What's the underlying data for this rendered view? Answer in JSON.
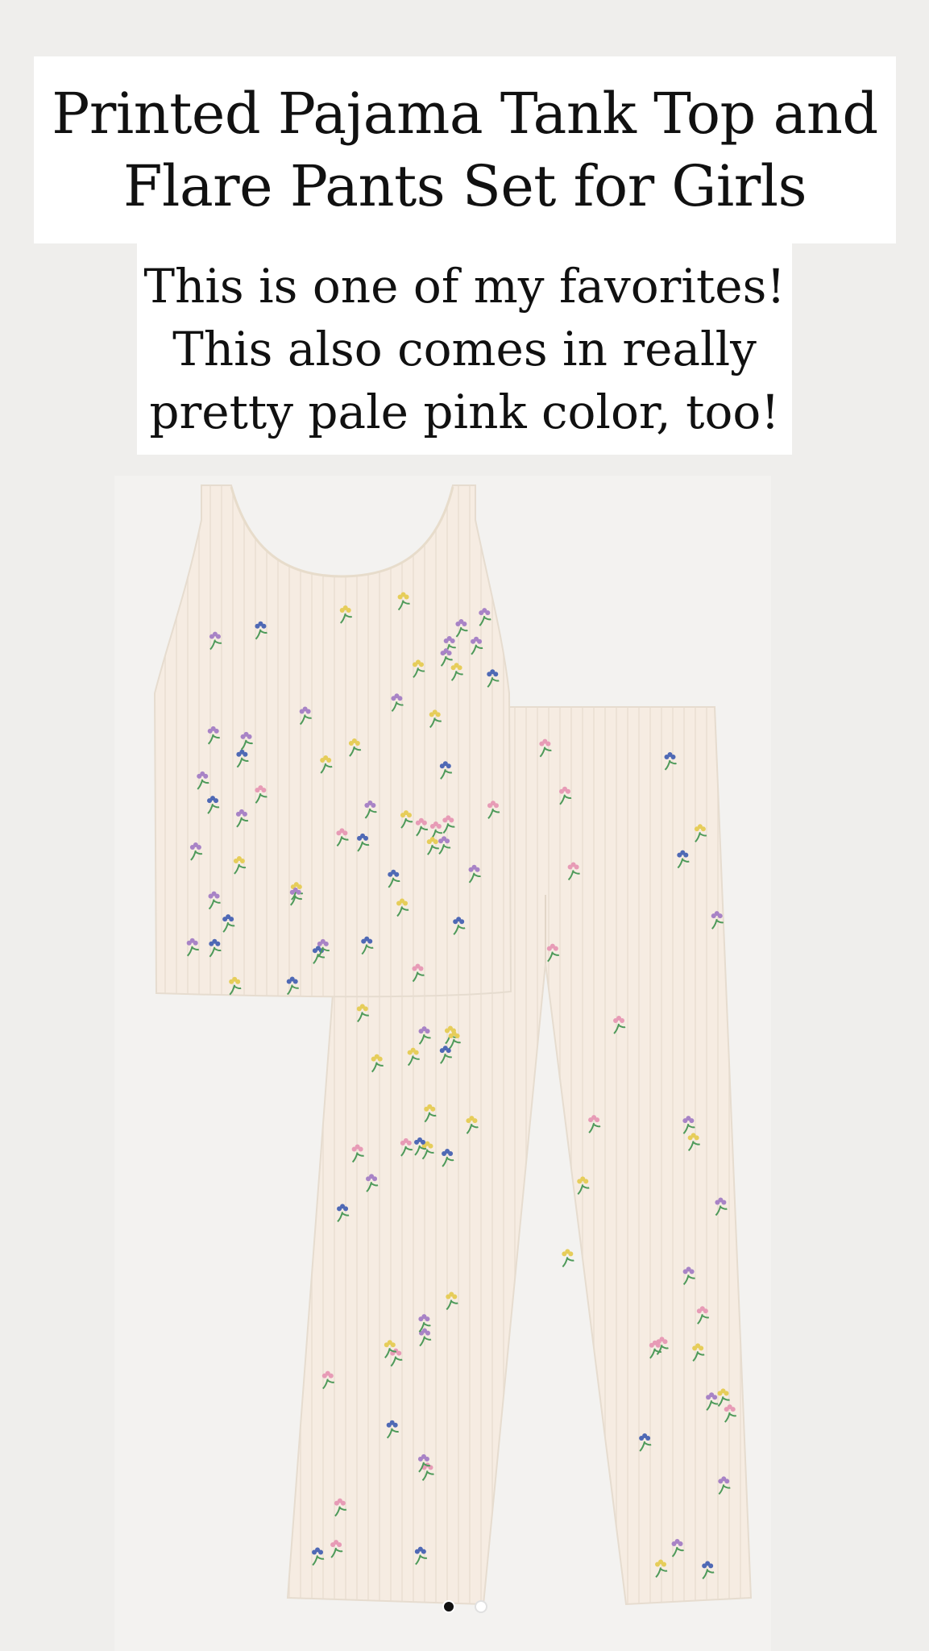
{
  "title": {
    "line1": "Printed Pajama Tank Top and",
    "line2": "Flare Pants Set for Girls"
  },
  "note": {
    "line1": "This is one of my favorites!",
    "line2": "This also comes in really",
    "line3": "pretty pale pink color, too!"
  },
  "product_image": {
    "alt": "Printed Pajama Tank Top and Flare Pants Set for Girls",
    "fabric_color": "#f6ece2",
    "print_colors": [
      "#4f69b5",
      "#a883c6",
      "#e79bb6",
      "#e6cd5a",
      "#4e9a5a"
    ]
  },
  "carousel": {
    "slide_count": 2,
    "active_index": 0
  }
}
